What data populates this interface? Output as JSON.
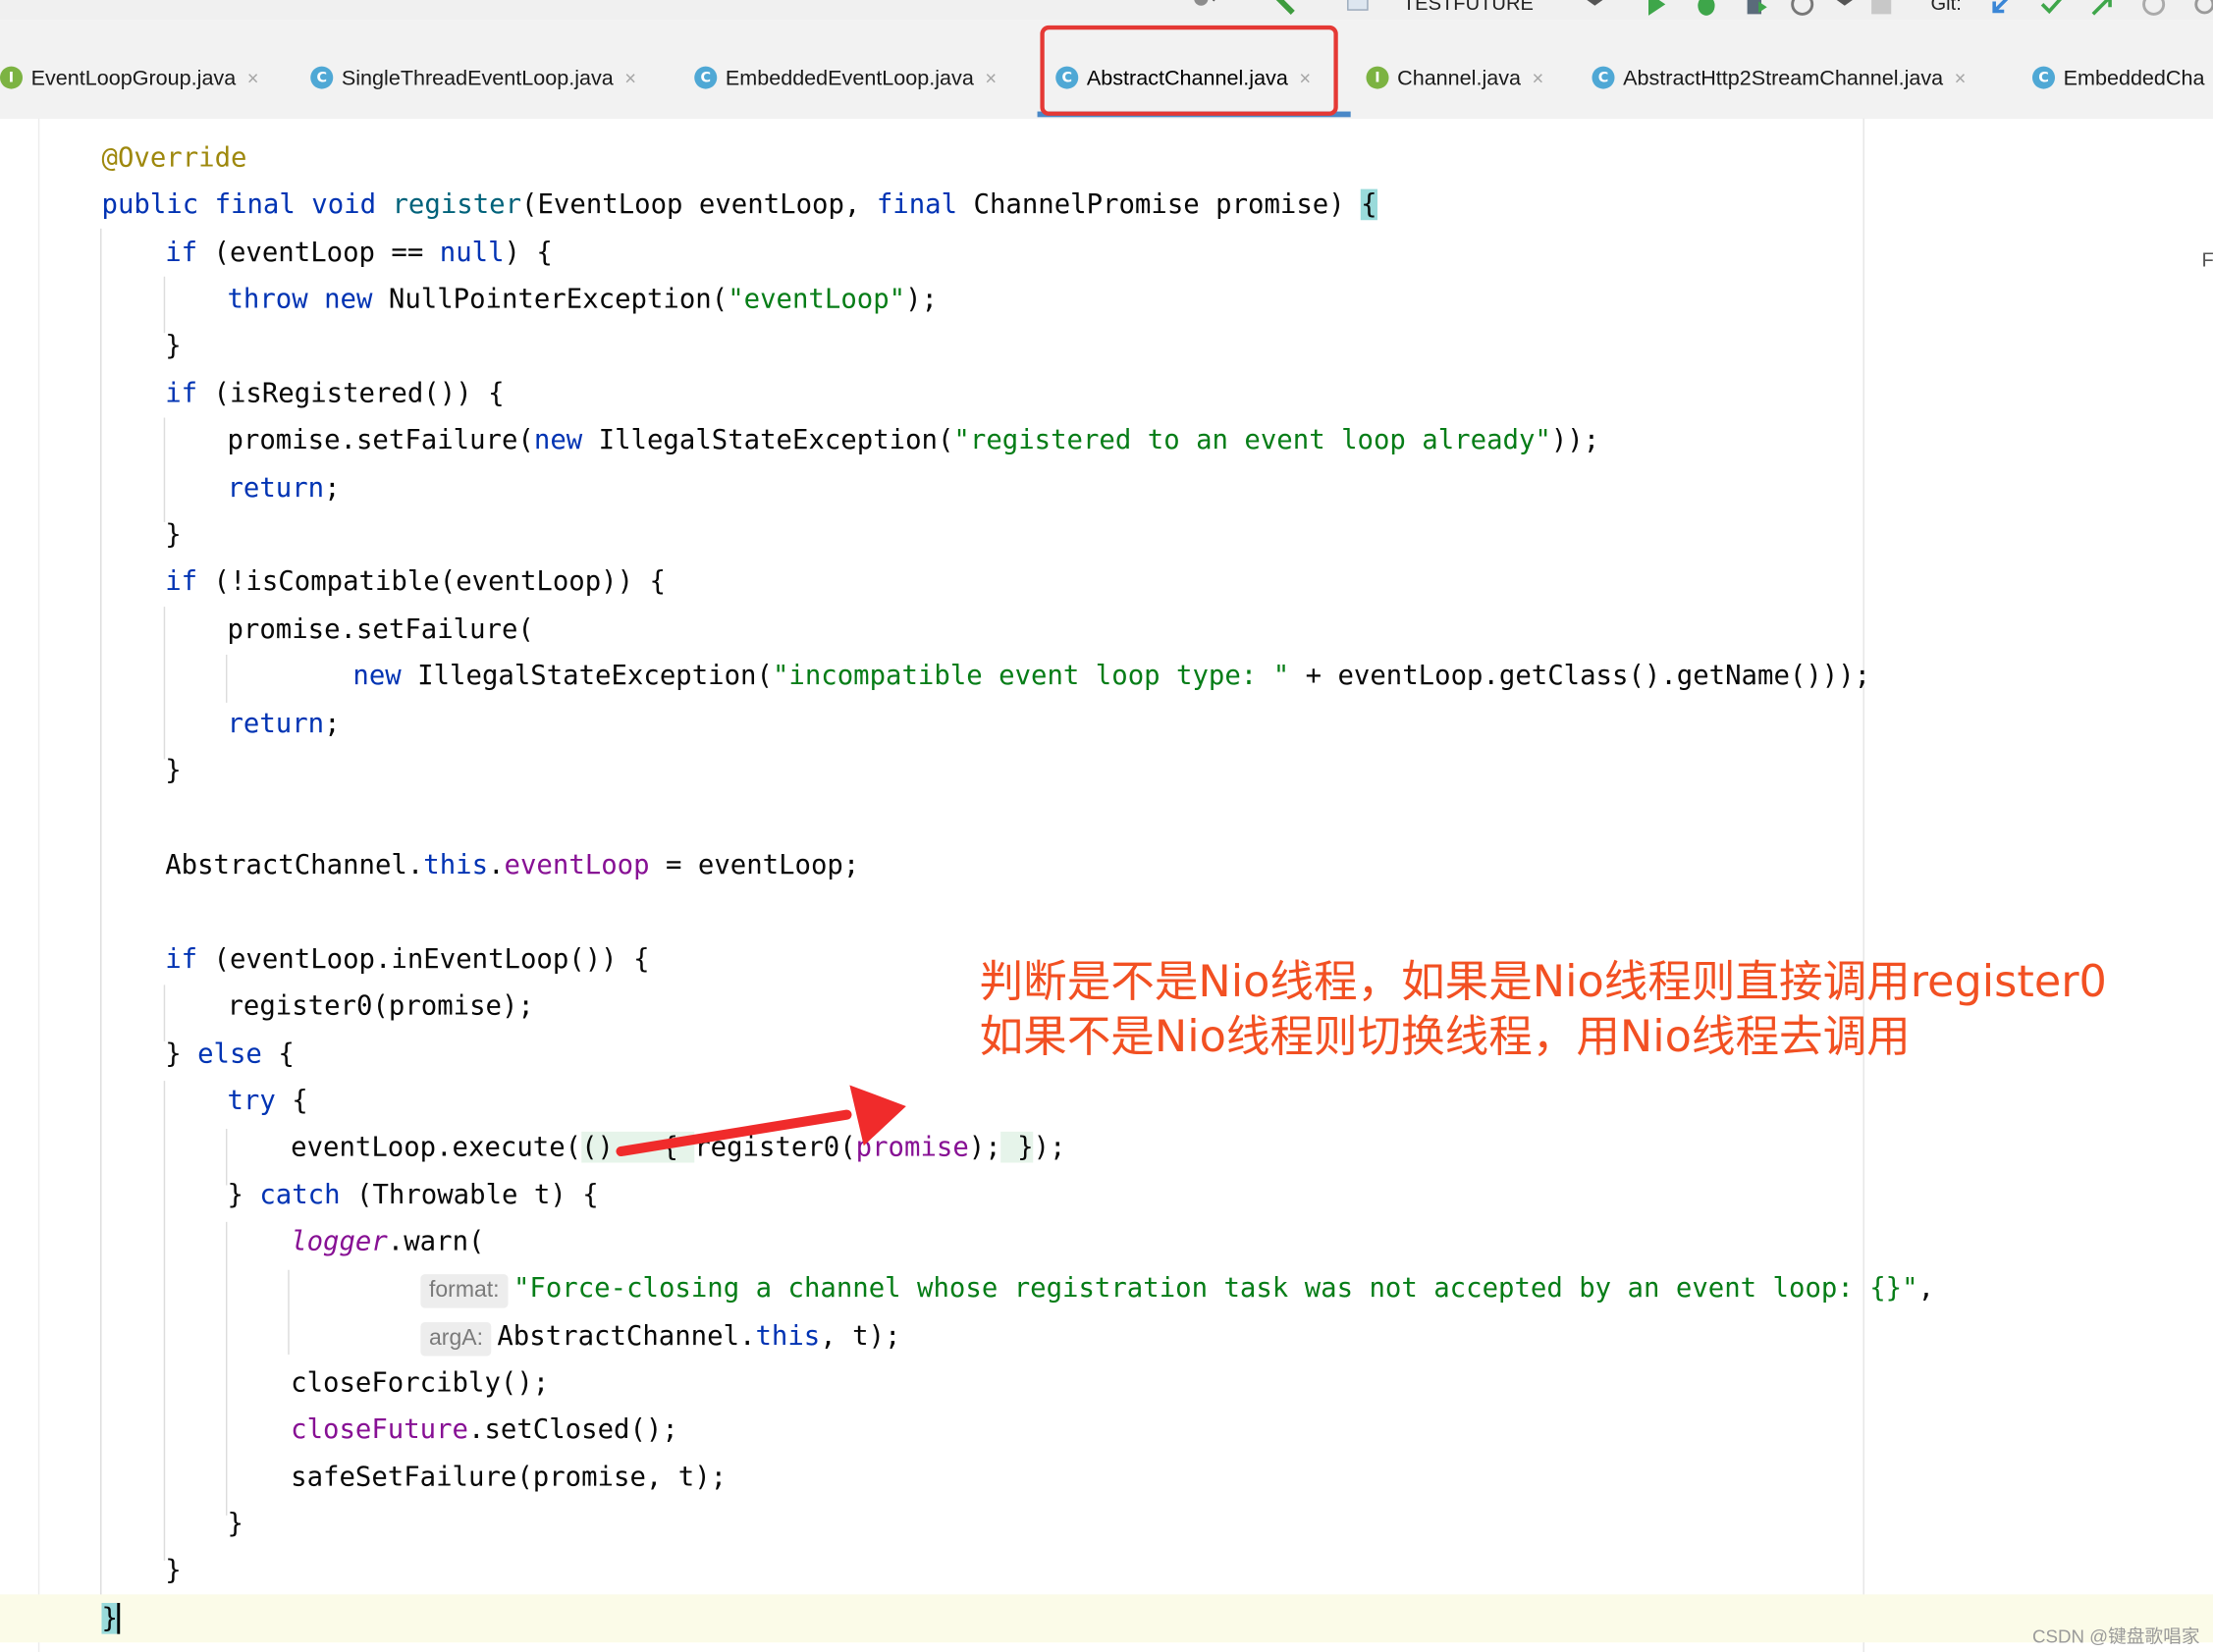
{
  "toolbar": {
    "run_config": "TESTFUTURE",
    "git_label": "Git:"
  },
  "tabs": [
    {
      "label": "EventLoopGroup.java",
      "icon": "interface-icon",
      "icon_char": "I"
    },
    {
      "label": "SingleThreadEventLoop.java",
      "icon": "class-icon",
      "icon_char": "C"
    },
    {
      "label": "EmbeddedEventLoop.java",
      "icon": "class-icon",
      "icon_char": "C"
    },
    {
      "label": "AbstractChannel.java",
      "icon": "class-icon",
      "icon_char": "C",
      "active": true
    },
    {
      "label": "Channel.java",
      "icon": "interface-icon",
      "icon_char": "I"
    },
    {
      "label": "AbstractHttp2StreamChannel.java",
      "icon": "class-icon",
      "icon_char": "C"
    },
    {
      "label": "EmbeddedCha",
      "icon": "class-icon",
      "icon_char": "C"
    }
  ],
  "close_glyph": "×",
  "inlay_hints": {
    "format": "format:",
    "argA": "argA:"
  },
  "annotation": {
    "line1": "判断是不是Nio线程，如果是Nio线程则直接调用register0",
    "line2": "如果不是Nio线程则切换线程，用Nio线程去调用",
    "color": "#f25022"
  },
  "watermark": "CSDN @键盘歌唱家",
  "colors": {
    "keyword": "#0033b3",
    "string": "#067d17",
    "annotation": "#9e880d",
    "field": "#871094",
    "highlight_border": "#e53935"
  }
}
